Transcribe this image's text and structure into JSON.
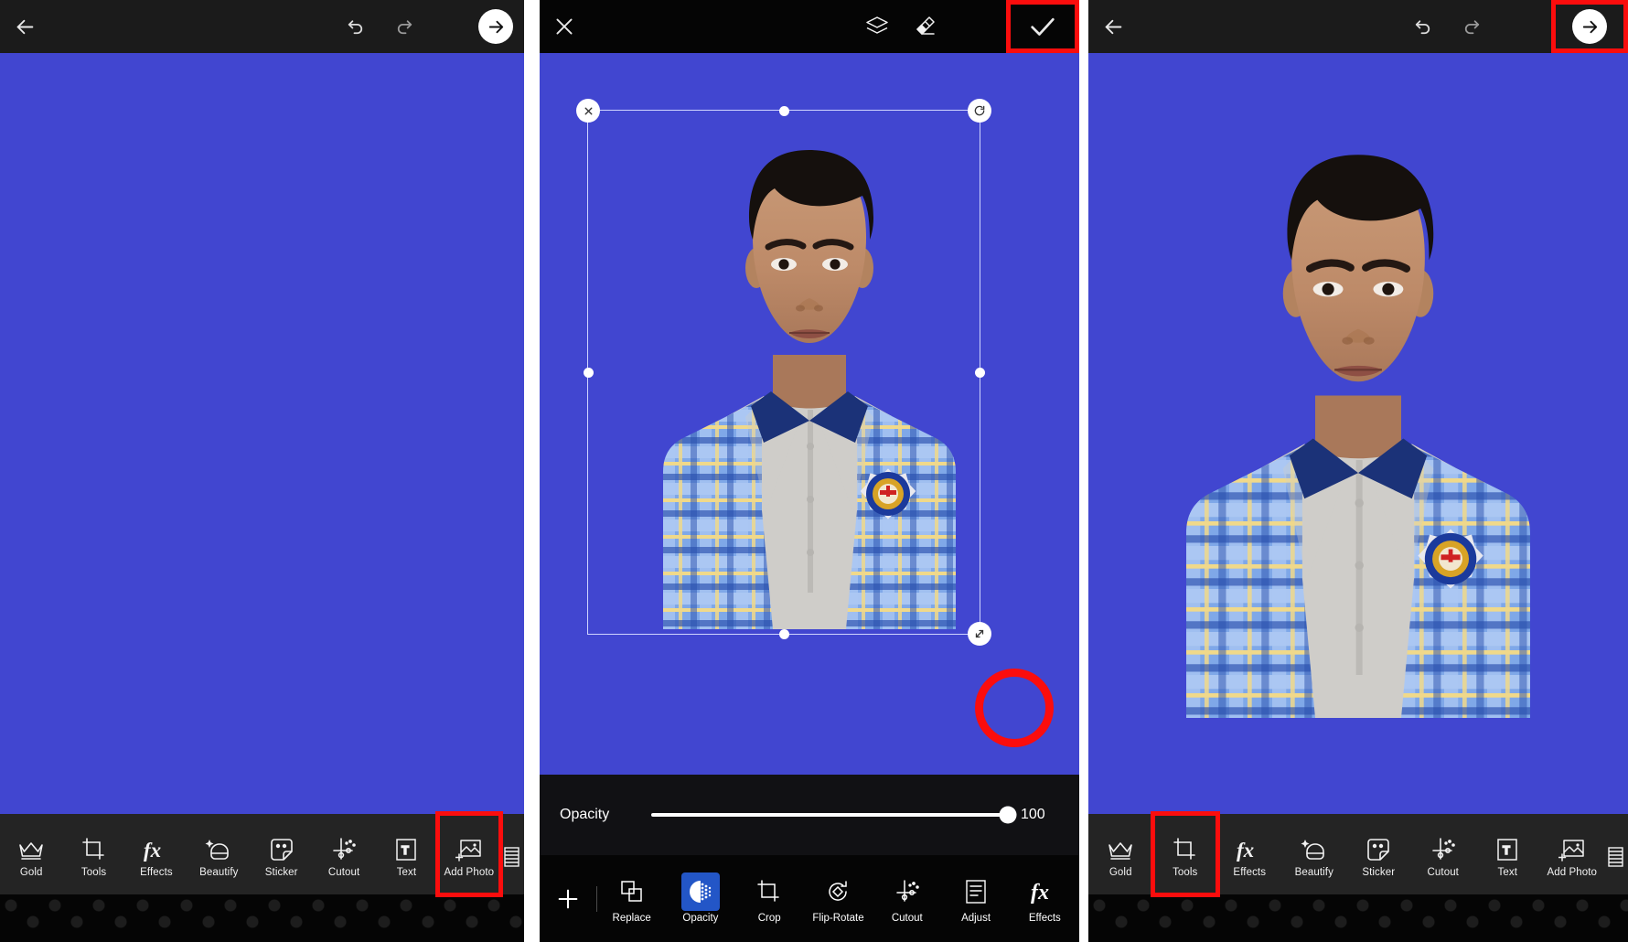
{
  "app": {
    "accent_blue": "#4146d0",
    "highlight_red": "#fb0d0d",
    "toolbar_bg": "#242424",
    "selected_tool_blue": "#2356c7"
  },
  "panel1": {
    "name": "editor-home",
    "topbar": {
      "back_icon": "arrow-left-icon",
      "undo_icon": "undo-icon",
      "redo_icon": "redo-icon",
      "next_icon": "arrow-right-circle-icon"
    },
    "canvas": {
      "background": "#4146d0",
      "content": "empty blue canvas"
    },
    "toolbar": [
      {
        "label": "Gold",
        "icon": "crown-icon",
        "selected": false
      },
      {
        "label": "Tools",
        "icon": "crop-frame-icon",
        "selected": false
      },
      {
        "label": "Effects",
        "icon": "fx-icon",
        "selected": false
      },
      {
        "label": "Beautify",
        "icon": "face-sparkle-icon",
        "selected": false
      },
      {
        "label": "Sticker",
        "icon": "sticker-icon",
        "selected": false
      },
      {
        "label": "Cutout",
        "icon": "cutout-scissors-icon",
        "selected": false
      },
      {
        "label": "Text",
        "icon": "text-box-icon",
        "selected": false
      },
      {
        "label": "Add Photo",
        "icon": "add-photo-icon",
        "selected": true
      }
    ]
  },
  "panel2": {
    "name": "photo-layer-editor",
    "topbar": {
      "close_icon": "close-x-icon",
      "layers_icon": "layers-icon",
      "eraser_icon": "eraser-icon",
      "confirm_icon": "check-icon",
      "confirm_highlighted": true
    },
    "selection": {
      "delete_handle_icon": "close-x-icon",
      "rotate_handle_icon": "rotate-icon",
      "resize_handle_icon": "resize-diagonal-icon",
      "resize_highlighted": true
    },
    "opacity": {
      "label": "Opacity",
      "value": "100",
      "percent": 100
    },
    "toolbar": [
      {
        "label": "",
        "icon": "plus-icon",
        "selected": false
      },
      {
        "label": "Replace",
        "icon": "replace-icon",
        "selected": false
      },
      {
        "label": "Opacity",
        "icon": "opacity-dots-icon",
        "selected": true
      },
      {
        "label": "Crop",
        "icon": "crop-frame-icon",
        "selected": false
      },
      {
        "label": "Flip-Rotate",
        "icon": "flip-rotate-icon",
        "selected": false
      },
      {
        "label": "Cutout",
        "icon": "cutout-scissors-icon",
        "selected": false
      },
      {
        "label": "Adjust",
        "icon": "adjust-sliders-icon",
        "selected": false
      },
      {
        "label": "Effects",
        "icon": "fx-icon",
        "selected": false
      }
    ]
  },
  "panel3": {
    "name": "editor-result",
    "topbar": {
      "back_icon": "arrow-left-icon",
      "undo_icon": "undo-icon",
      "redo_icon": "redo-icon",
      "next_icon": "arrow-right-circle-icon",
      "next_highlighted": true
    },
    "toolbar": [
      {
        "label": "Gold",
        "icon": "crown-icon",
        "selected": false
      },
      {
        "label": "Tools",
        "icon": "crop-frame-icon",
        "selected": true
      },
      {
        "label": "Effects",
        "icon": "fx-icon",
        "selected": false
      },
      {
        "label": "Beautify",
        "icon": "face-sparkle-icon",
        "selected": false
      },
      {
        "label": "Sticker",
        "icon": "sticker-icon",
        "selected": false
      },
      {
        "label": "Cutout",
        "icon": "cutout-scissors-icon",
        "selected": false
      },
      {
        "label": "Text",
        "icon": "text-box-icon",
        "selected": false
      },
      {
        "label": "Add Photo",
        "icon": "add-photo-icon",
        "selected": false
      }
    ]
  }
}
